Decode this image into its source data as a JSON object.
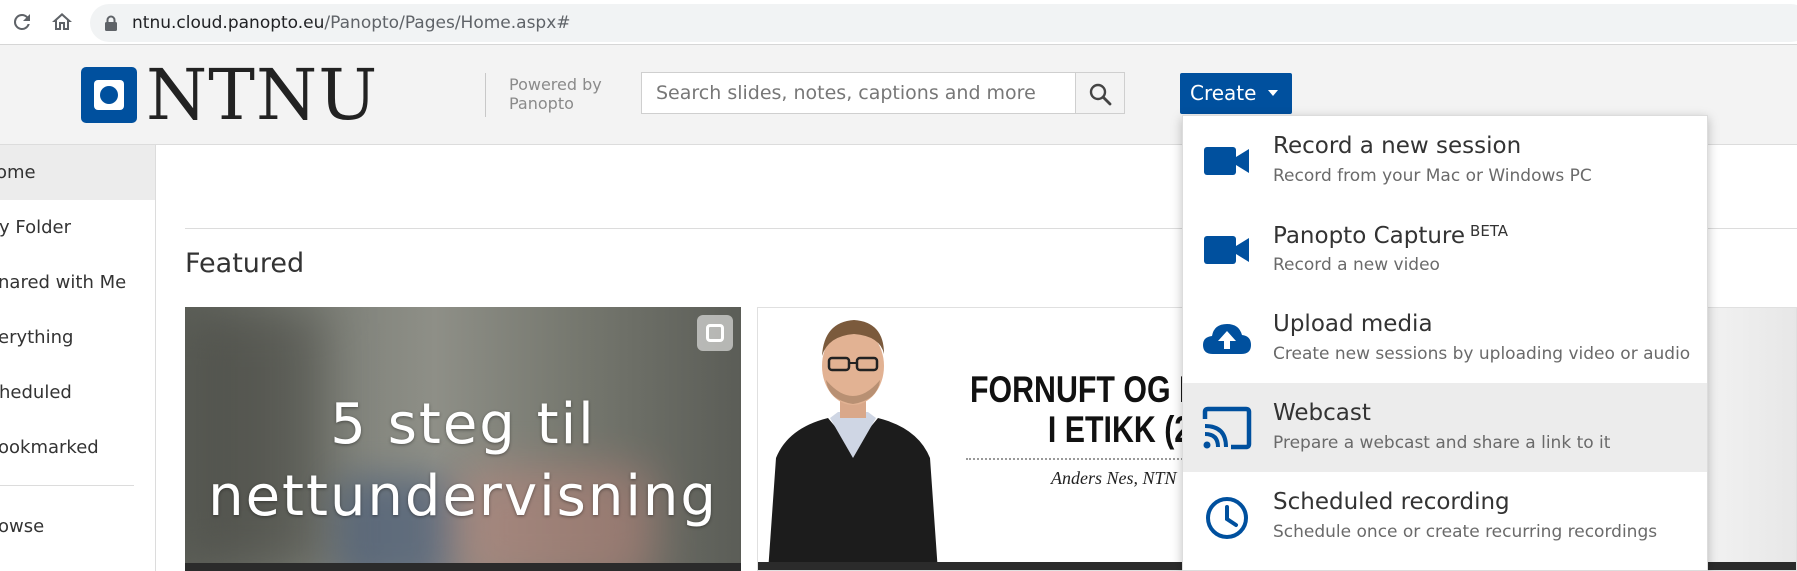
{
  "browser": {
    "url_host": "ntnu.cloud.panopto.eu",
    "url_path": "/Panopto/Pages/Home.aspx#"
  },
  "header": {
    "logo_text": "NTNU",
    "powered_by_line1": "Powered by",
    "powered_by_line2": "Panopto",
    "search_placeholder": "Search slides, notes, captions and more",
    "create_label": "Create"
  },
  "sidebar": {
    "items": [
      {
        "label": "ome"
      },
      {
        "label": "y Folder"
      },
      {
        "label": "nared with Me"
      },
      {
        "label": "erything"
      },
      {
        "label": "heduled"
      },
      {
        "label": "ookmarked"
      },
      {
        "label": "owse"
      }
    ]
  },
  "main": {
    "featured_title": "Featured",
    "card1_line1": "5 steg til",
    "card1_line2": "nettundervisning",
    "card2_title_line1": "FORNUFT OG FØ",
    "card2_title_line2": "I ETIKK (2",
    "card2_author": "Anders Nes, NTN"
  },
  "dropdown": {
    "items": [
      {
        "title": "Record a new session",
        "sub": "Record from your Mac or Windows PC",
        "icon": "video-camera-icon"
      },
      {
        "title": "Panopto Capture",
        "badge": "BETA",
        "sub": "Record a new video",
        "icon": "video-camera-icon"
      },
      {
        "title": "Upload media",
        "sub": "Create new sessions by uploading video or audio",
        "icon": "cloud-upload-icon"
      },
      {
        "title": "Webcast",
        "sub": "Prepare a webcast and share a link to it",
        "icon": "cast-icon"
      },
      {
        "title": "Scheduled recording",
        "sub": "Schedule once or create recurring recordings",
        "icon": "clock-icon"
      }
    ]
  },
  "colors": {
    "brand": "#00509e",
    "menu_highlight": "#ececec"
  }
}
